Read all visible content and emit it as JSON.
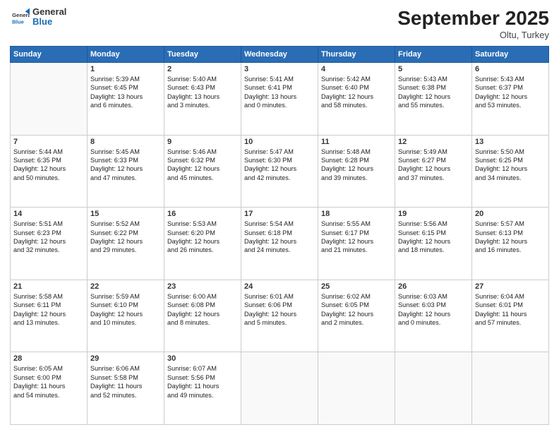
{
  "logo": {
    "line1": "General",
    "line2": "Blue"
  },
  "title": "September 2025",
  "location": "Oltu, Turkey",
  "weekdays": [
    "Sunday",
    "Monday",
    "Tuesday",
    "Wednesday",
    "Thursday",
    "Friday",
    "Saturday"
  ],
  "weeks": [
    [
      {
        "day": "",
        "content": ""
      },
      {
        "day": "1",
        "content": "Sunrise: 5:39 AM\nSunset: 6:45 PM\nDaylight: 13 hours\nand 6 minutes."
      },
      {
        "day": "2",
        "content": "Sunrise: 5:40 AM\nSunset: 6:43 PM\nDaylight: 13 hours\nand 3 minutes."
      },
      {
        "day": "3",
        "content": "Sunrise: 5:41 AM\nSunset: 6:41 PM\nDaylight: 13 hours\nand 0 minutes."
      },
      {
        "day": "4",
        "content": "Sunrise: 5:42 AM\nSunset: 6:40 PM\nDaylight: 12 hours\nand 58 minutes."
      },
      {
        "day": "5",
        "content": "Sunrise: 5:43 AM\nSunset: 6:38 PM\nDaylight: 12 hours\nand 55 minutes."
      },
      {
        "day": "6",
        "content": "Sunrise: 5:43 AM\nSunset: 6:37 PM\nDaylight: 12 hours\nand 53 minutes."
      }
    ],
    [
      {
        "day": "7",
        "content": "Sunrise: 5:44 AM\nSunset: 6:35 PM\nDaylight: 12 hours\nand 50 minutes."
      },
      {
        "day": "8",
        "content": "Sunrise: 5:45 AM\nSunset: 6:33 PM\nDaylight: 12 hours\nand 47 minutes."
      },
      {
        "day": "9",
        "content": "Sunrise: 5:46 AM\nSunset: 6:32 PM\nDaylight: 12 hours\nand 45 minutes."
      },
      {
        "day": "10",
        "content": "Sunrise: 5:47 AM\nSunset: 6:30 PM\nDaylight: 12 hours\nand 42 minutes."
      },
      {
        "day": "11",
        "content": "Sunrise: 5:48 AM\nSunset: 6:28 PM\nDaylight: 12 hours\nand 39 minutes."
      },
      {
        "day": "12",
        "content": "Sunrise: 5:49 AM\nSunset: 6:27 PM\nDaylight: 12 hours\nand 37 minutes."
      },
      {
        "day": "13",
        "content": "Sunrise: 5:50 AM\nSunset: 6:25 PM\nDaylight: 12 hours\nand 34 minutes."
      }
    ],
    [
      {
        "day": "14",
        "content": "Sunrise: 5:51 AM\nSunset: 6:23 PM\nDaylight: 12 hours\nand 32 minutes."
      },
      {
        "day": "15",
        "content": "Sunrise: 5:52 AM\nSunset: 6:22 PM\nDaylight: 12 hours\nand 29 minutes."
      },
      {
        "day": "16",
        "content": "Sunrise: 5:53 AM\nSunset: 6:20 PM\nDaylight: 12 hours\nand 26 minutes."
      },
      {
        "day": "17",
        "content": "Sunrise: 5:54 AM\nSunset: 6:18 PM\nDaylight: 12 hours\nand 24 minutes."
      },
      {
        "day": "18",
        "content": "Sunrise: 5:55 AM\nSunset: 6:17 PM\nDaylight: 12 hours\nand 21 minutes."
      },
      {
        "day": "19",
        "content": "Sunrise: 5:56 AM\nSunset: 6:15 PM\nDaylight: 12 hours\nand 18 minutes."
      },
      {
        "day": "20",
        "content": "Sunrise: 5:57 AM\nSunset: 6:13 PM\nDaylight: 12 hours\nand 16 minutes."
      }
    ],
    [
      {
        "day": "21",
        "content": "Sunrise: 5:58 AM\nSunset: 6:11 PM\nDaylight: 12 hours\nand 13 minutes."
      },
      {
        "day": "22",
        "content": "Sunrise: 5:59 AM\nSunset: 6:10 PM\nDaylight: 12 hours\nand 10 minutes."
      },
      {
        "day": "23",
        "content": "Sunrise: 6:00 AM\nSunset: 6:08 PM\nDaylight: 12 hours\nand 8 minutes."
      },
      {
        "day": "24",
        "content": "Sunrise: 6:01 AM\nSunset: 6:06 PM\nDaylight: 12 hours\nand 5 minutes."
      },
      {
        "day": "25",
        "content": "Sunrise: 6:02 AM\nSunset: 6:05 PM\nDaylight: 12 hours\nand 2 minutes."
      },
      {
        "day": "26",
        "content": "Sunrise: 6:03 AM\nSunset: 6:03 PM\nDaylight: 12 hours\nand 0 minutes."
      },
      {
        "day": "27",
        "content": "Sunrise: 6:04 AM\nSunset: 6:01 PM\nDaylight: 11 hours\nand 57 minutes."
      }
    ],
    [
      {
        "day": "28",
        "content": "Sunrise: 6:05 AM\nSunset: 6:00 PM\nDaylight: 11 hours\nand 54 minutes."
      },
      {
        "day": "29",
        "content": "Sunrise: 6:06 AM\nSunset: 5:58 PM\nDaylight: 11 hours\nand 52 minutes."
      },
      {
        "day": "30",
        "content": "Sunrise: 6:07 AM\nSunset: 5:56 PM\nDaylight: 11 hours\nand 49 minutes."
      },
      {
        "day": "",
        "content": ""
      },
      {
        "day": "",
        "content": ""
      },
      {
        "day": "",
        "content": ""
      },
      {
        "day": "",
        "content": ""
      }
    ]
  ]
}
